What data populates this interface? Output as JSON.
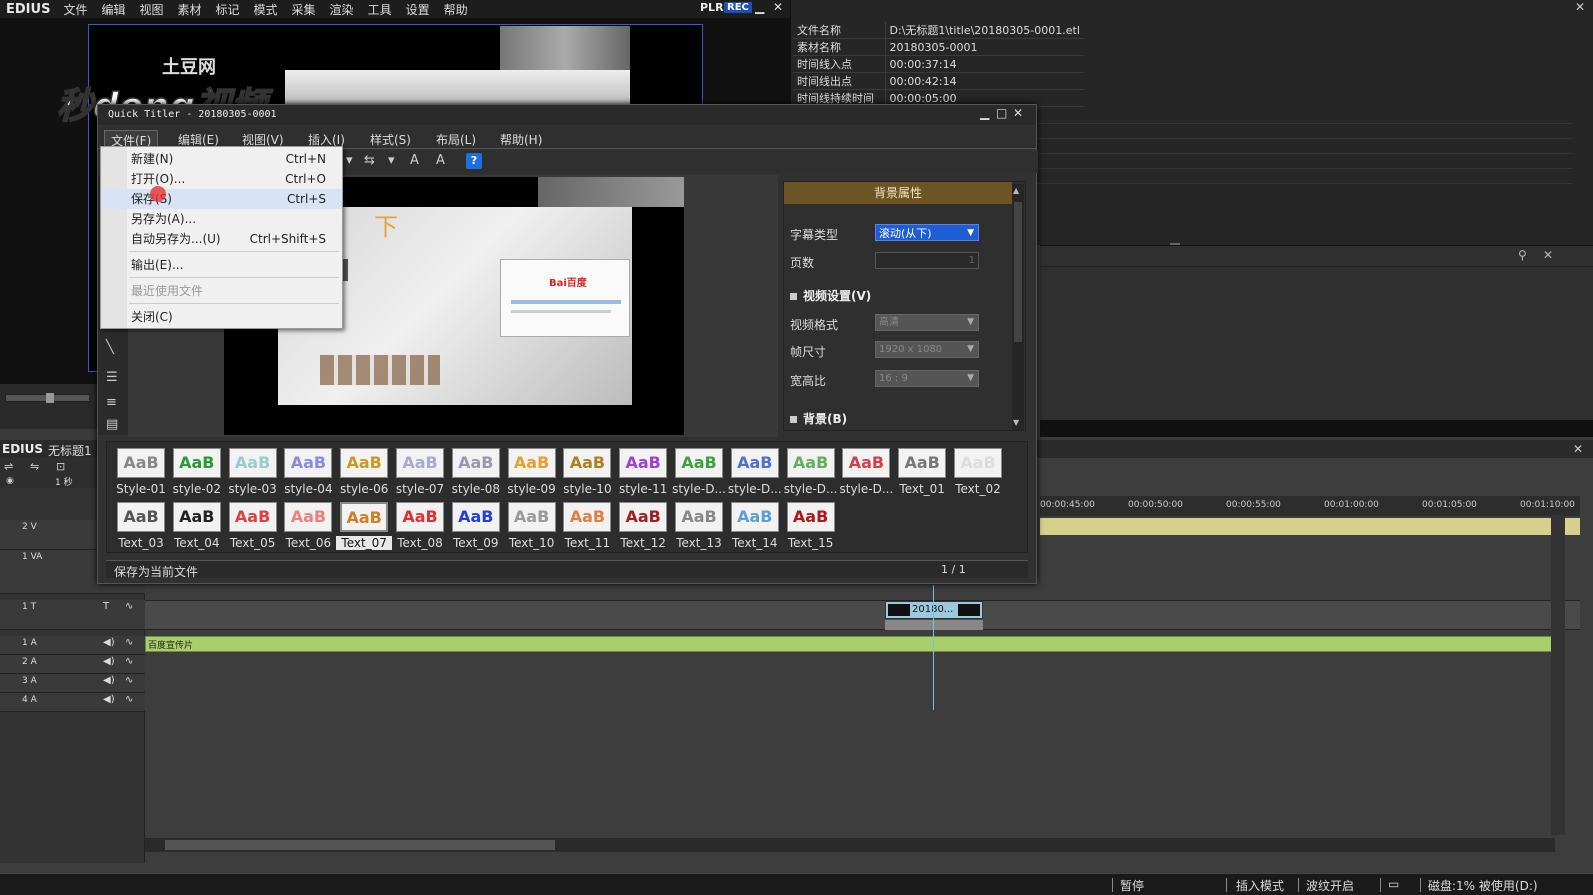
{
  "app": {
    "logo": "EDIUS",
    "menu": [
      "文件",
      "编辑",
      "视图",
      "素材",
      "标记",
      "模式",
      "采集",
      "渲染",
      "工具",
      "设置",
      "帮助"
    ],
    "plr": "PLR",
    "rec": "REC"
  },
  "watermark": {
    "top": "土豆网",
    "main": "秒dong视频"
  },
  "info_panel": {
    "rows": [
      {
        "key": "文件名称",
        "value": "D:\\无标题1\\title\\20180305-0001.etl"
      },
      {
        "key": "素材名称",
        "value": "20180305-0001"
      },
      {
        "key": "时间线入点",
        "value": "00:00:37:14"
      },
      {
        "key": "时间线出点",
        "value": "00:00:42:14"
      },
      {
        "key": "时间线持续时间",
        "value": "00:00:05:00"
      }
    ]
  },
  "quick_titler": {
    "title": "Quick Titler - 20180305-0001",
    "menu": [
      "文件(F)",
      "编辑(E)",
      "视图(V)",
      "插入(I)",
      "样式(S)",
      "布局(L)",
      "帮助(H)"
    ],
    "help_icon": "?",
    "canvas": {
      "baidu": "Bai百度",
      "glyph": "下"
    },
    "file_menu": [
      {
        "label": "新建(N)",
        "shortcut": "Ctrl+N"
      },
      {
        "label": "打开(O)...",
        "shortcut": "Ctrl+O"
      },
      {
        "label": "保存(S)",
        "shortcut": "Ctrl+S"
      },
      {
        "label": "另存为(A)...",
        "shortcut": ""
      },
      {
        "label": "自动另存为...(U)",
        "shortcut": "Ctrl+Shift+S"
      },
      {
        "label": "输出(E)...",
        "shortcut": ""
      },
      {
        "label": "最近使用文件",
        "shortcut": ""
      },
      {
        "label": "关闭(C)",
        "shortcut": ""
      }
    ],
    "bg_props": {
      "header": "背景属性",
      "subtitle_type_label": "字幕类型",
      "subtitle_type_value": "滚动(从下)",
      "page_count_label": "页数",
      "page_count_value": "1",
      "video_section": "视频设置(V)",
      "video_format_label": "视频格式",
      "video_format_value": "高清",
      "frame_size_label": "帧尺寸",
      "frame_size_value": "1920 x 1080",
      "aspect_label": "宽高比",
      "aspect_value": "16 : 9",
      "bg_section": "背景(B)"
    },
    "styles_row1": [
      "Style-01",
      "style-02",
      "style-03",
      "style-04",
      "style-06",
      "style-07",
      "style-08",
      "style-09",
      "style-10",
      "style-11",
      "style-D...",
      "style-D...",
      "style-D...",
      "style-D...",
      "Text_01",
      "Text_02"
    ],
    "styles_row2": [
      "Text_03",
      "Text_04",
      "Text_05",
      "Text_06",
      "Text_07",
      "Text_08",
      "Text_09",
      "Text_10",
      "Text_11",
      "Text_12",
      "Text_13",
      "Text_14",
      "Text_15"
    ],
    "swatch_text": "AaB",
    "selected_style": "Text_07",
    "status_text": "保存为当前文件",
    "page_indicator": "1 / 1"
  },
  "timeline": {
    "logo": "EDIUS",
    "project": "无标题1",
    "zoom": "1 秒",
    "ruler": [
      "00:00:45:00",
      "00:00:50:00",
      "00:00:55:00",
      "00:01:00:00",
      "00:01:05:00",
      "00:01:10:00"
    ],
    "tracks": [
      "2 V",
      "1 VA",
      "1 T",
      "1 A",
      "2 A",
      "3 A",
      "4 A"
    ],
    "title_clip": "20180...",
    "audio_clip": "百度宣传片"
  },
  "status_bar": {
    "pause": "暂停",
    "insert_mode": "插入模式",
    "ripple": "波纹开启",
    "disk": "磁盘:1% 被使用(D:)"
  },
  "colors": {
    "accent_blue": "#1f5dd4",
    "bg_header_gold": "#6c5425",
    "audio_track_green": "#a9ce6b",
    "video_track_yellow": "#d7cf8c"
  }
}
